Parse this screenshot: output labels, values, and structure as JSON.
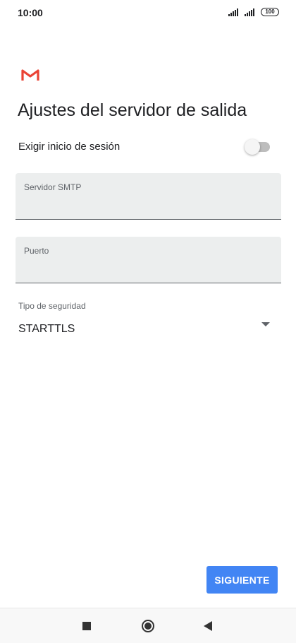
{
  "status_bar": {
    "time": "10:00",
    "battery_level": "100",
    "icons": [
      "signal-icon",
      "signal-icon",
      "battery-icon"
    ]
  },
  "app": {
    "logo": "gmail-logo",
    "colors": {
      "accent": "#4285f4",
      "logo_red": "#ea4335",
      "field_bg": "#eceeee"
    }
  },
  "page": {
    "title": "Ajustes del servidor de salida"
  },
  "login_toggle": {
    "label": "Exigir inicio de sesión",
    "checked": false
  },
  "fields": {
    "smtp_server": {
      "label": "Servidor SMTP",
      "value": ""
    },
    "port": {
      "label": "Puerto",
      "value": ""
    }
  },
  "security": {
    "label": "Tipo de seguridad",
    "selected": "STARTTLS"
  },
  "actions": {
    "next_label": "SIGUIENTE"
  },
  "nav_bar": {
    "icons": [
      "recent-apps-icon",
      "home-icon",
      "back-icon"
    ]
  }
}
